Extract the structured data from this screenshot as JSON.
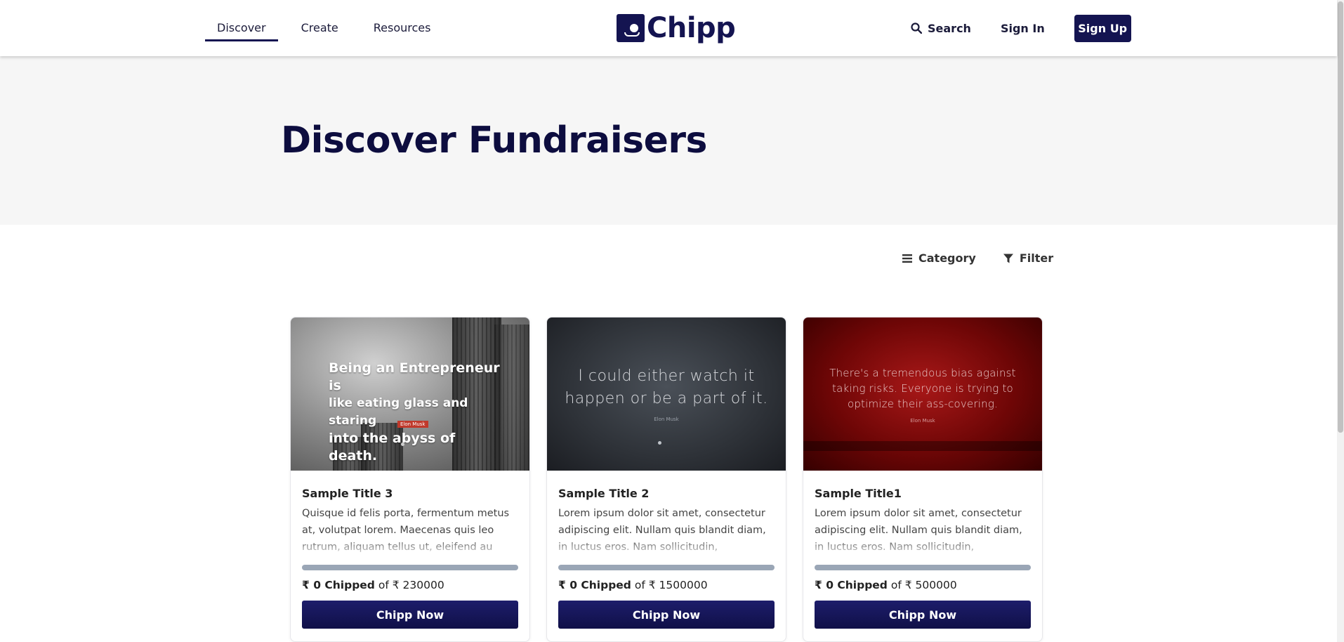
{
  "header": {
    "nav": [
      {
        "label": "Discover",
        "active": true
      },
      {
        "label": "Create",
        "active": false
      },
      {
        "label": "Resources",
        "active": false
      }
    ],
    "logo_text": "Chipp",
    "search_label": "Search",
    "signin_label": "Sign In",
    "signup_label": "Sign Up"
  },
  "hero": {
    "title": "Discover Fundraisers"
  },
  "toolbar": {
    "category_label": "Category",
    "filter_label": "Filter"
  },
  "cards": [
    {
      "image": {
        "quote_lines": [
          "Being an Entrepreneur is",
          "like eating glass and staring",
          "into the abyss of death."
        ],
        "author": "Elon Musk"
      },
      "title": "Sample Title 3",
      "description": "Quisque id felis porta, fermentum metus at, volutpat lorem. Maecenas quis leo rutrum, aliquam tellus ut, eleifend au",
      "progress": 0,
      "currency": "₹",
      "chipped": "0 Chipped",
      "of": "of",
      "goal": "230000",
      "button": "Chipp Now"
    },
    {
      "image": {
        "quote_lines": [
          "I could either watch it",
          "happen or be a part of it."
        ],
        "author": "Elon Musk"
      },
      "title": "Sample Title 2",
      "description": "Lorem ipsum dolor sit amet, consectetur adipiscing elit. Nullam quis blandit diam, in luctus eros. Nam sollicitudin, ",
      "progress": 0,
      "currency": "₹",
      "chipped": "0 Chipped",
      "of": "of",
      "goal": "1500000",
      "button": "Chipp Now"
    },
    {
      "image": {
        "quote_lines": [
          "There's a tremendous bias against",
          "taking risks. Everyone is trying to",
          "optimize their ass-covering."
        ],
        "author": "Elon Musk"
      },
      "title": "Sample Title1",
      "description": "Lorem ipsum dolor sit amet, consectetur adipiscing elit. Nullam quis blandit diam, in luctus eros. Nam sollicitudin, ",
      "progress": 0,
      "currency": "₹",
      "chipped": "0 Chipped",
      "of": "of",
      "goal": "500000",
      "button": "Chipp Now"
    }
  ],
  "colors": {
    "brand": "#141451",
    "progress_track": "#9aa6b6",
    "hero_bg": "#f6f6f6"
  },
  "icons": {
    "search": "search-icon",
    "category": "list-icon",
    "filter": "filter-icon"
  }
}
